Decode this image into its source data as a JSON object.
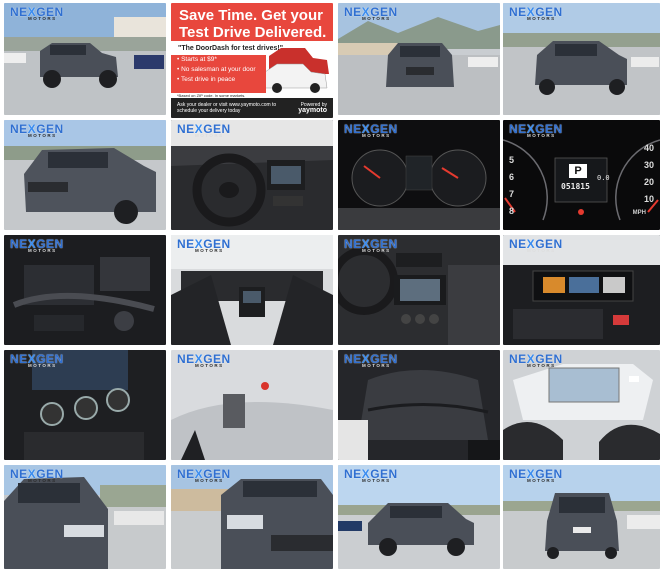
{
  "logo": {
    "brand_prefix": "NE",
    "brand_x": "X",
    "brand_suffix": "GEN",
    "subtitle": "MOTORS"
  },
  "ad": {
    "headline": "Save Time. Get your Test Drive Delivered.",
    "tagline": "\"The DoorDash for test drives!\"",
    "bullets": [
      "Starts at $9*",
      "No salesman at your door",
      "Test drive in peace"
    ],
    "fineprint": "*Based on ZIP code. In some markets.",
    "ask": "Ask your dealer or visit www.yaymoto.com to schedule your delivery today",
    "powered_by": "Powered by",
    "powered_brand": "yaymoto"
  },
  "gauge": {
    "gear": "P",
    "odometer": "051815",
    "trip": "0.0",
    "speed_unit": "MPH",
    "tach_marks": [
      "5",
      "6",
      "7",
      "8"
    ],
    "speed_marks": [
      "40",
      "30",
      "20",
      "10"
    ]
  },
  "thumbnails": [
    {
      "name": "photo-front-left-exterior"
    },
    {
      "name": "photo-doordash-ad"
    },
    {
      "name": "photo-front-exterior"
    },
    {
      "name": "photo-front-right-exterior"
    },
    {
      "name": "photo-front-three-quarter"
    },
    {
      "name": "photo-steering-wheel"
    },
    {
      "name": "photo-instrument-cluster"
    },
    {
      "name": "photo-odometer-closeup"
    },
    {
      "name": "photo-engine-bay"
    },
    {
      "name": "photo-dashboard-from-rear"
    },
    {
      "name": "photo-center-console"
    },
    {
      "name": "photo-infotainment-display"
    },
    {
      "name": "photo-climate-controls"
    },
    {
      "name": "photo-interior-detail"
    },
    {
      "name": "photo-rear-seat"
    },
    {
      "name": "photo-sunroof"
    },
    {
      "name": "photo-front-left-closeup"
    },
    {
      "name": "photo-headlight-closeup"
    },
    {
      "name": "photo-side-profile"
    },
    {
      "name": "photo-rear-exterior"
    }
  ],
  "colors": {
    "logo_blue": "#2f6fd1",
    "ad_red": "#e8473d",
    "car_gray": "#4a4f58"
  }
}
